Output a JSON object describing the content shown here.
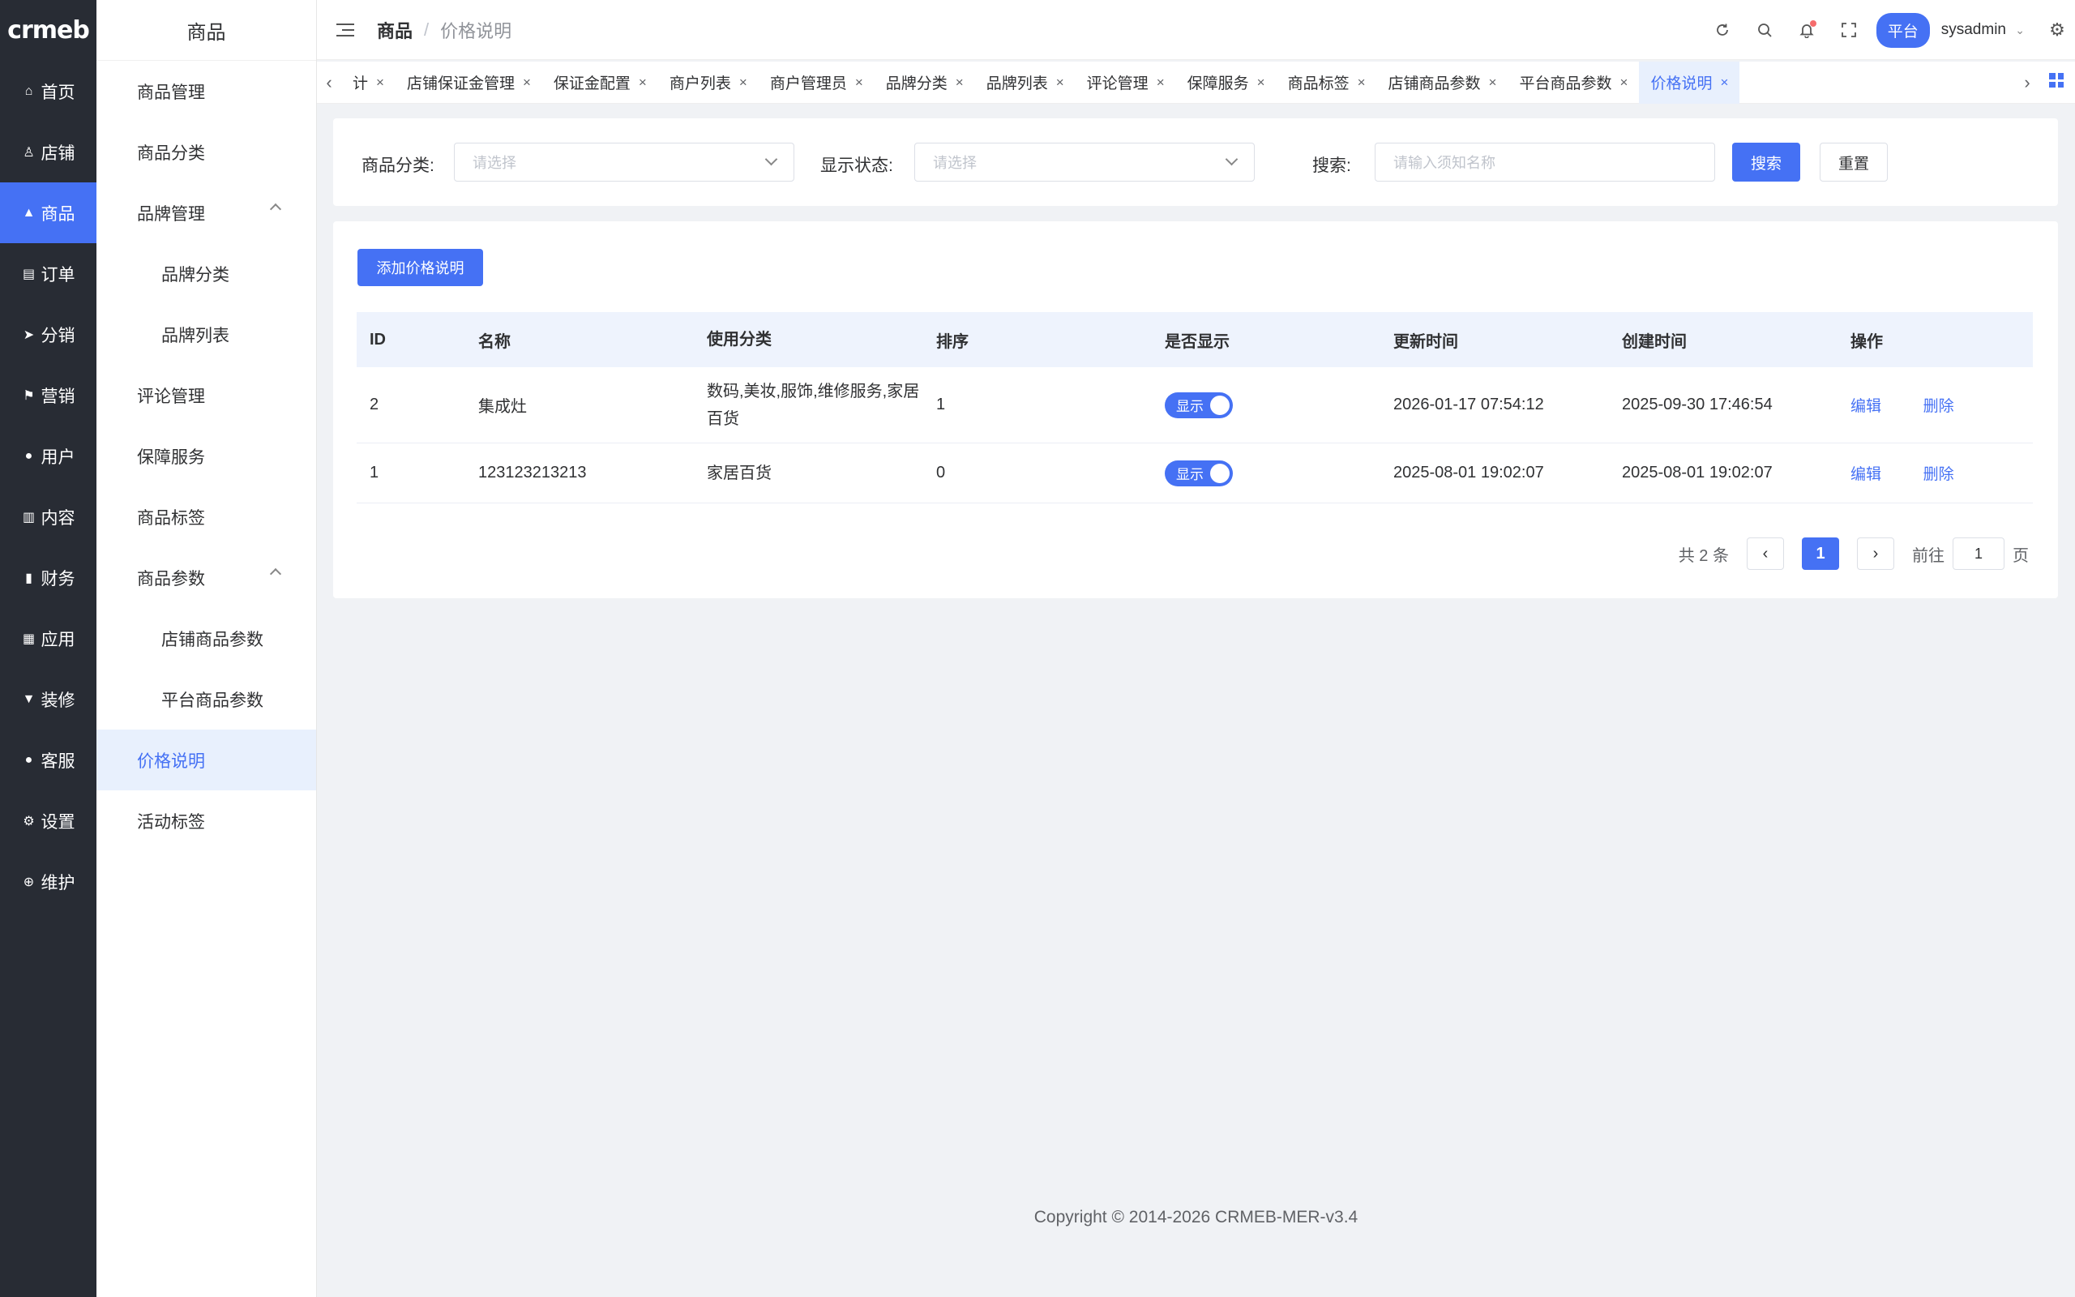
{
  "brand": {
    "logo_text": "crmeb",
    "accent": "#4571f4"
  },
  "rail": [
    {
      "icon": "home-icon",
      "glyph": "⌂",
      "label": "首页"
    },
    {
      "icon": "store-icon",
      "glyph": "♙",
      "label": "店铺"
    },
    {
      "icon": "bag-icon",
      "glyph": "▲",
      "label": "商品",
      "active": true
    },
    {
      "icon": "clipboard-icon",
      "glyph": "▤",
      "label": "订单"
    },
    {
      "icon": "paper-plane-icon",
      "glyph": "➤",
      "label": "分销"
    },
    {
      "icon": "flag-icon",
      "glyph": "⚑",
      "label": "营销"
    },
    {
      "icon": "user-icon",
      "glyph": "●",
      "label": "用户"
    },
    {
      "icon": "content-icon",
      "glyph": "▥",
      "label": "内容"
    },
    {
      "icon": "bar-chart-icon",
      "glyph": "▮",
      "label": "财务"
    },
    {
      "icon": "grid-apps-icon",
      "glyph": "▦",
      "label": "应用"
    },
    {
      "icon": "brush-icon",
      "glyph": "▼",
      "label": "装修"
    },
    {
      "icon": "service-icon",
      "glyph": "●",
      "label": "客服"
    },
    {
      "icon": "gear-icon",
      "glyph": "⚙",
      "label": "设置"
    },
    {
      "icon": "plus-circle-icon",
      "glyph": "⊕",
      "label": "维护"
    }
  ],
  "submenu": {
    "title": "商品",
    "items": [
      {
        "label": "商品管理",
        "level": 1
      },
      {
        "label": "商品分类",
        "level": 1
      },
      {
        "label": "品牌管理",
        "level": 1,
        "expanded": true
      },
      {
        "label": "品牌分类",
        "level": 2
      },
      {
        "label": "品牌列表",
        "level": 2
      },
      {
        "label": "评论管理",
        "level": 1
      },
      {
        "label": "保障服务",
        "level": 1
      },
      {
        "label": "商品标签",
        "level": 1
      },
      {
        "label": "商品参数",
        "level": 1,
        "expanded": true
      },
      {
        "label": "店铺商品参数",
        "level": 2
      },
      {
        "label": "平台商品参数",
        "level": 2
      },
      {
        "label": "价格说明",
        "level": 1,
        "active": true
      },
      {
        "label": "活动标签",
        "level": 1
      }
    ]
  },
  "header": {
    "breadcrumb_root": "商品",
    "breadcrumb_sep": "/",
    "breadcrumb_current": "价格说明",
    "platform_label": "平台",
    "username": "sysadmin"
  },
  "tabs": [
    {
      "label": "计"
    },
    {
      "label": "店铺保证金管理"
    },
    {
      "label": "保证金配置"
    },
    {
      "label": "商户列表"
    },
    {
      "label": "商户管理员"
    },
    {
      "label": "品牌分类"
    },
    {
      "label": "品牌列表"
    },
    {
      "label": "评论管理"
    },
    {
      "label": "保障服务"
    },
    {
      "label": "商品标签"
    },
    {
      "label": "店铺商品参数"
    },
    {
      "label": "平台商品参数"
    },
    {
      "label": "价格说明",
      "active": true
    }
  ],
  "filters": {
    "category_label": "商品分类:",
    "category_placeholder": "请选择",
    "status_label": "显示状态:",
    "status_placeholder": "请选择",
    "search_label": "搜索:",
    "search_placeholder": "请输入须知名称",
    "search_button": "搜索",
    "reset_button": "重置"
  },
  "actions": {
    "add_button": "添加价格说明"
  },
  "table": {
    "columns": [
      "ID",
      "名称",
      "使用分类",
      "排序",
      "是否显示",
      "更新时间",
      "创建时间",
      "操作"
    ],
    "rows": [
      {
        "id": "2",
        "name": "集成灶",
        "category": "数码,美妆,服饰,维修服务,家居百货",
        "sort": "1",
        "show": "显示",
        "updated": "2026-01-17 07:54:12",
        "created": "2025-09-30 17:46:54",
        "edit": "编辑",
        "delete": "删除"
      },
      {
        "id": "1",
        "name": "123123213213",
        "category": "家居百货",
        "sort": "0",
        "show": "显示",
        "updated": "2025-08-01 19:02:07",
        "created": "2025-08-01 19:02:07",
        "edit": "编辑",
        "delete": "删除"
      }
    ]
  },
  "pagination": {
    "total_text": "共 2 条",
    "current_page": "1",
    "goto_label": "前往",
    "goto_value": "1",
    "page_suffix": "页"
  },
  "footer": {
    "copyright": "Copyright © 2014-2026 CRMEB-MER-v3.4"
  }
}
